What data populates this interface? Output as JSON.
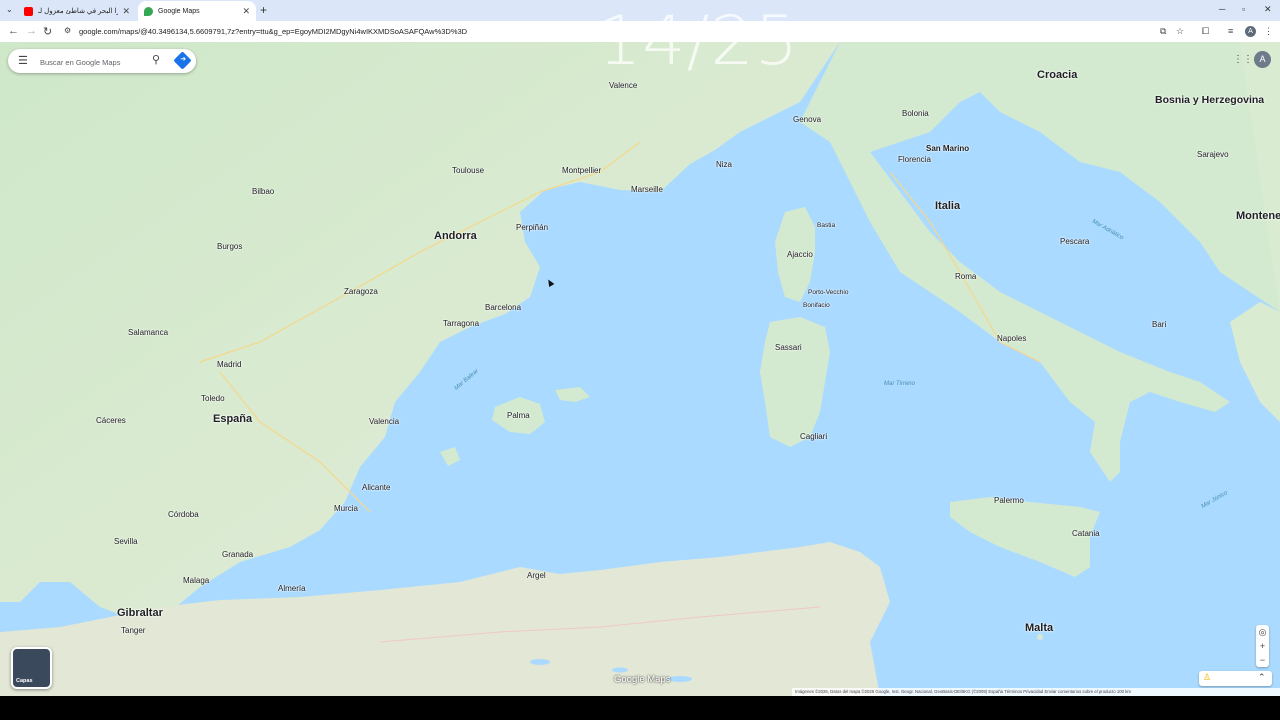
{
  "browser": {
    "tabs": [
      {
        "title": "جاميرا البحر في شاطئ معزول لـ...",
        "favicon_color": "#ff0000",
        "active": false
      },
      {
        "title": "Google Maps",
        "favicon_color": "#34a853",
        "active": true
      }
    ],
    "new_tab": "+",
    "url": "google.com/maps/@40.3496134,5.6609791,7z?entry=ttu&g_ep=EgoyMDI2MDgyNi4wIKXMDSoASAFQAw%3D%3D",
    "profile_initial": "A"
  },
  "overlay_counter": "14/25",
  "maps": {
    "search_placeholder": "Buscar en Google Maps",
    "account_initial": "A",
    "layers_label": "Capas",
    "brand": "Google Maps",
    "footer": "Imágenes ©2026, Datos del mapa ©2026 Google, Inst. Geogr. Nacional, GeoBasis-DE/BKG (©2009)    España    Términos    Privacidad    Enviar comentarios sobre el producto    100 km"
  },
  "labels": {
    "countries": [
      "Croacia",
      "Bosnia y Herzegovina",
      "Andorra",
      "Italia",
      "San Marino",
      "España",
      "Malta",
      "Gibraltar",
      "Montenegro"
    ],
    "cities": [
      "Genova",
      "Bolonia",
      "Valence",
      "Montpellier",
      "Marseille",
      "Niza",
      "Toulouse",
      "Bilbao",
      "Zaragoza",
      "Barcelona",
      "Madrid",
      "Valencia",
      "Palma",
      "Sevilla",
      "Malaga",
      "Roma",
      "Napoles",
      "Bari",
      "Florencia",
      "Cagliari",
      "Palermo",
      "Catania",
      "Argel",
      "Tanger",
      "Sarajevo",
      "Pescara",
      "Alicante",
      "Murcia",
      "Granada",
      "Córdoba",
      "Tarragona",
      "Perpiñán",
      "Ajaccio",
      "Sassari",
      "Toledo",
      "Burgos",
      "Salamanca",
      "Cáceres",
      "Almería",
      "Bastia",
      "Porto-Vecchio",
      "Bonifacio",
      "Mar Tirreno",
      "Mar Balear",
      "Mar Adriático",
      "Mar Jónico"
    ]
  }
}
